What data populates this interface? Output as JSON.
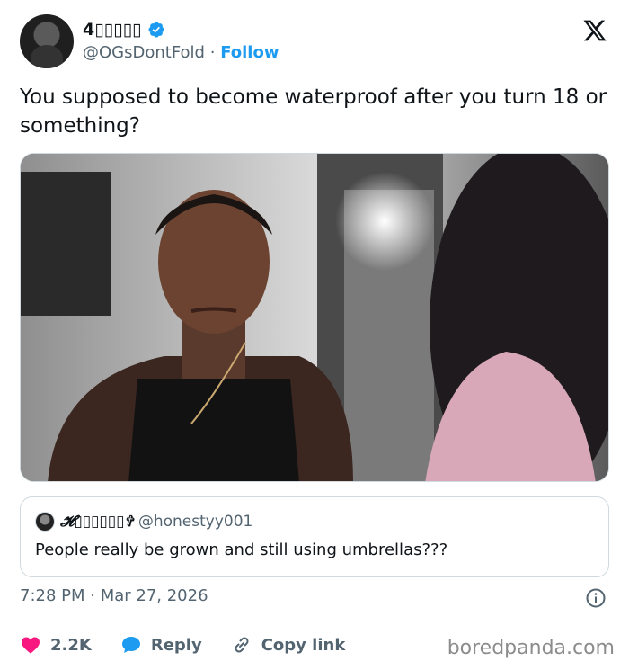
{
  "author": {
    "name": "4▯▯▯▯▯",
    "handle": "@OGsDontFold",
    "separator": "·",
    "follow_label": "Follow"
  },
  "tweet": {
    "text": "You supposed to become waterproof after you turn 18 or something?"
  },
  "quote": {
    "name": "𝓗▯▯▯▯▯▯✞",
    "handle": "@honestyy001",
    "text": "People really be grown and still using umbrellas???"
  },
  "meta": {
    "timestamp": "7:28 PM · Mar 27, 2026"
  },
  "actions": {
    "likes": "2.2K",
    "reply": "Reply",
    "copy_link": "Copy link"
  },
  "watermark": "boredpanda.com",
  "colors": {
    "accent": "#1d9bf0",
    "like": "#f91880",
    "muted": "#536471"
  }
}
